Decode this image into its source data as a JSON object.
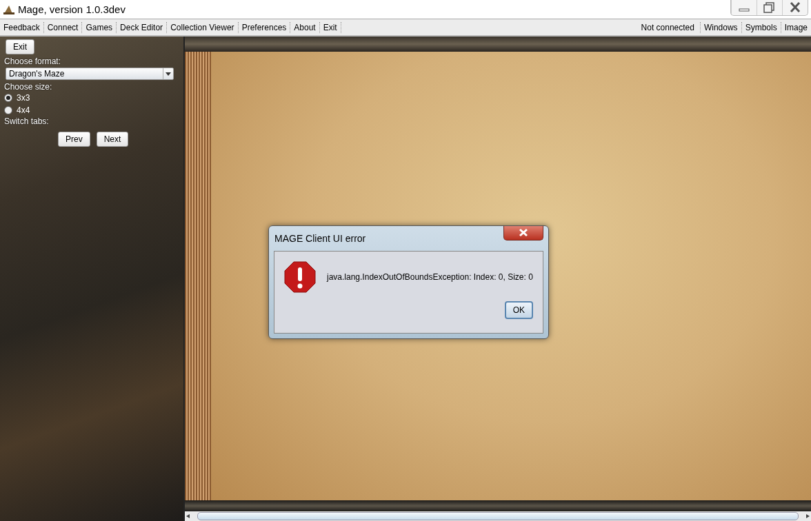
{
  "window": {
    "title": "Mage, version 1.0.3dev"
  },
  "menu_bar": {
    "left_items": [
      "Feedback",
      "Connect",
      "Games",
      "Deck Editor",
      "Collection Viewer",
      "Preferences",
      "About",
      "Exit"
    ],
    "status": "Not connected",
    "right_items": [
      "Windows",
      "Symbols",
      "Image"
    ]
  },
  "side_panel": {
    "exit_button": "Exit",
    "format_label": "Choose format:",
    "format_value": "Dragon's Maze",
    "size_label": "Choose size:",
    "sizes": [
      {
        "label": "3x3",
        "selected": true
      },
      {
        "label": "4x4",
        "selected": false
      }
    ],
    "tabs_label": "Switch tabs:",
    "buttons": [
      "Prev",
      "Next"
    ]
  },
  "dialog": {
    "title": "MAGE Client UI error",
    "message": "java.lang.IndexOutOfBoundsException: Index: 0, Size: 0",
    "button": "OK"
  }
}
